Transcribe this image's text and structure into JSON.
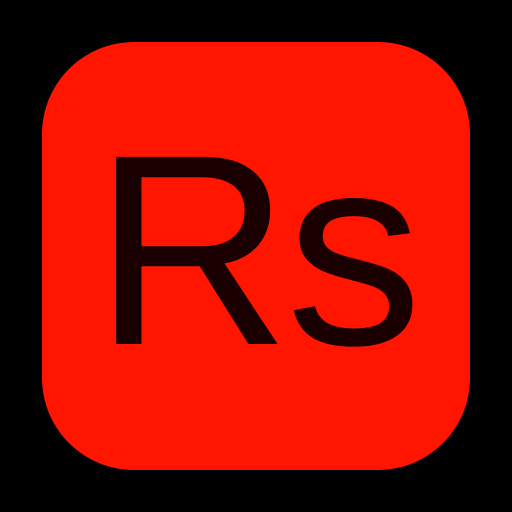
{
  "app_icon": {
    "label": "Rs",
    "tile_color": "#ff1500",
    "label_color": "#1a0000",
    "background_color": "#000000"
  }
}
